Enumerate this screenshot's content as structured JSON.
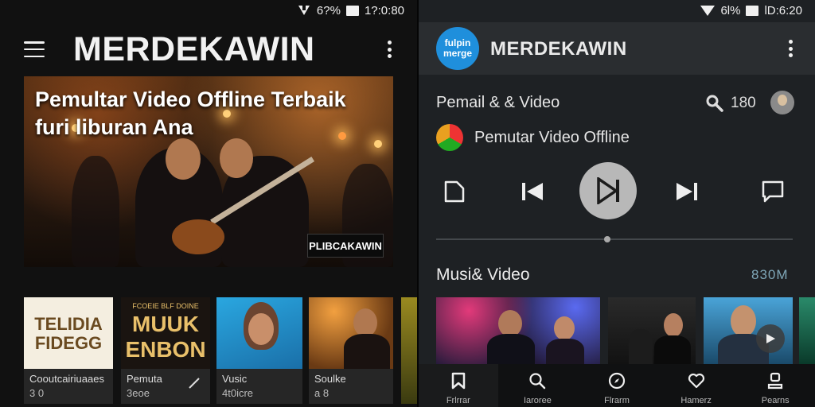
{
  "left": {
    "status": {
      "signal_label": "",
      "battery": "6?%",
      "time": "1?:0:80"
    },
    "app_title": "MERDEKAWIN",
    "hero": {
      "title_line1": "Pemultar Video Offline Terbaik",
      "title_line2": "furi liburan Ana",
      "badge": "PLIBCAKAWIN"
    },
    "thumbnails": [
      {
        "art_text": "TELIDIA\nFIDEGG",
        "label": "Cooutcairiuaaes",
        "sub": "3 0",
        "bg": "#f4eee0",
        "fg": "#6a4a20"
      },
      {
        "art_text": "MUUK\nENBON",
        "label": "Pemuta",
        "sub": "3eoe",
        "bg": "#1a1410",
        "fg": "#e9c06a",
        "top_text": "FCOEIE BLF DOINE"
      },
      {
        "art_text": "",
        "label": "Vusic",
        "sub": "4t0icre",
        "bg": "#2a9fd6",
        "fg": "#ffffff"
      },
      {
        "art_text": "",
        "label": "Soulke",
        "sub": "a 8",
        "bg": "#8a4a1a",
        "fg": "#ffffff"
      }
    ]
  },
  "right": {
    "status": {
      "battery": "6l%",
      "time": "lD:6:20"
    },
    "logo_text": "fulpin\nmerge",
    "app_title": "MERDEKAWIN",
    "header_label": "Pemail & & Video",
    "count": "180",
    "app_row_label": "Pemutar Video Offline",
    "progress_fraction": 0.48,
    "section_title": "Musi& Video",
    "section_count": "830M",
    "nav": [
      {
        "label": "Frlrrar",
        "icon": "bookmark-icon"
      },
      {
        "label": "Iaroree",
        "icon": "search-icon"
      },
      {
        "label": "Flrarm",
        "icon": "explore-icon"
      },
      {
        "label": "Hamerz",
        "icon": "heart-icon"
      },
      {
        "label": "Pearns",
        "icon": "profile-icon"
      }
    ]
  },
  "colors": {
    "accent_blue": "#1f8fdc",
    "play_button": "#b8b8b8",
    "app_bar_right": "#2a2d30"
  }
}
